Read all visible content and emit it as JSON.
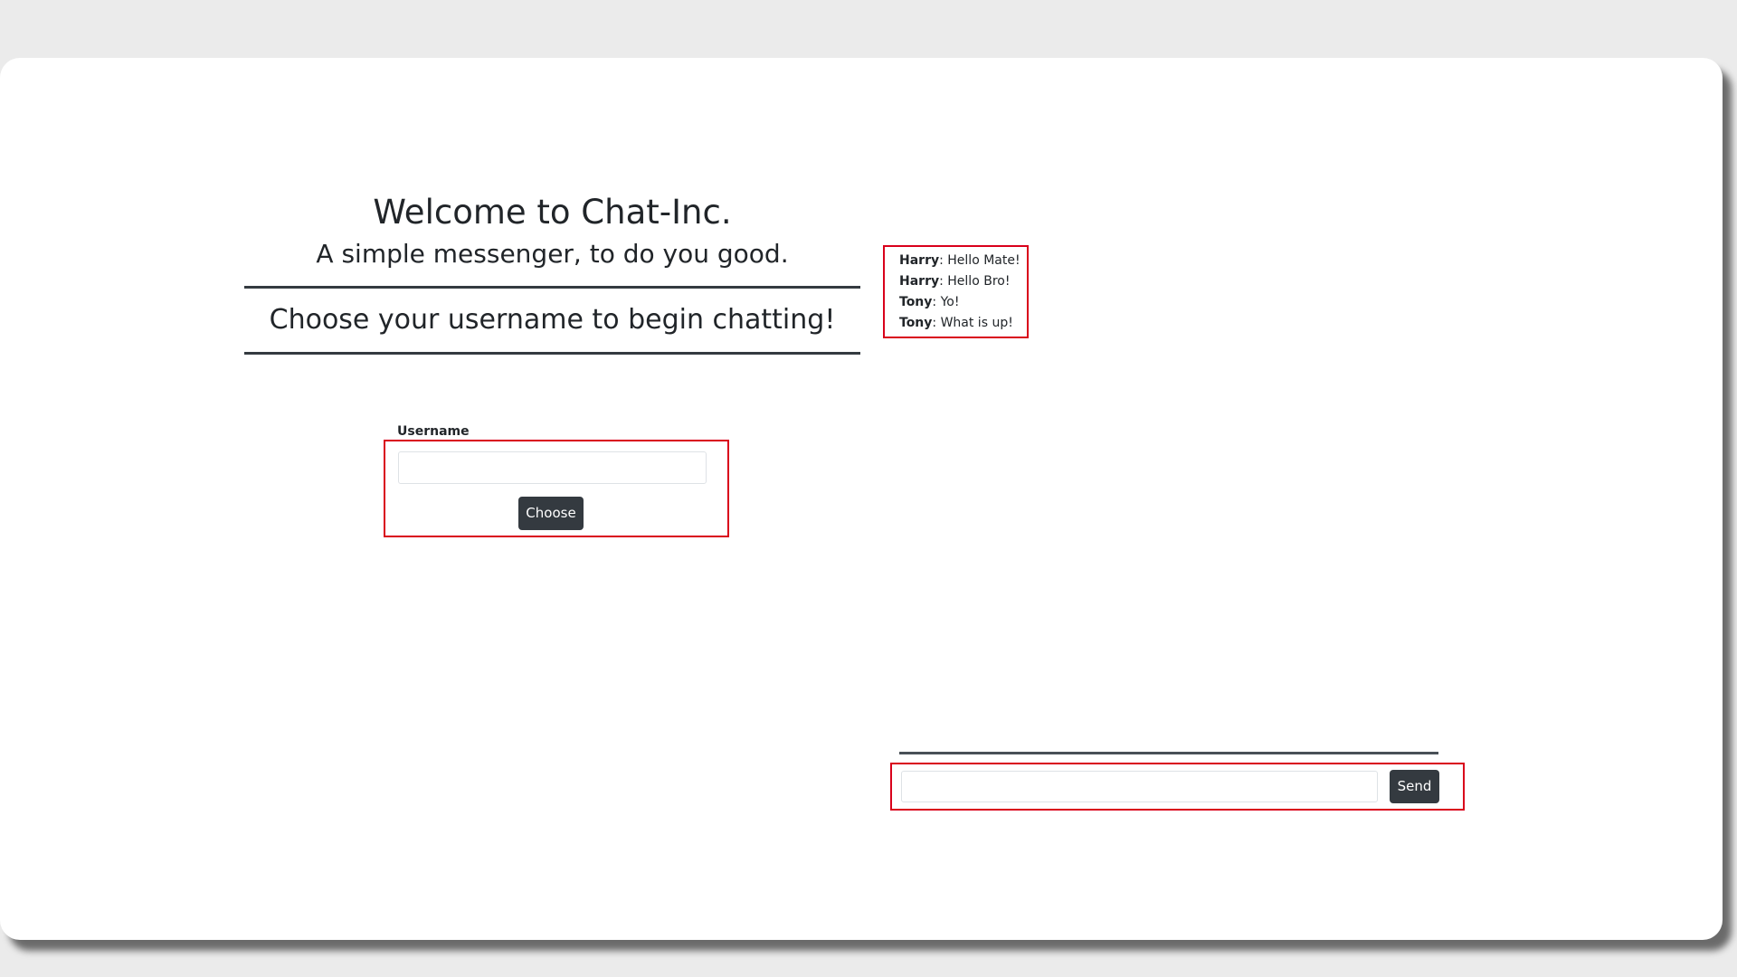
{
  "welcome": {
    "title": "Welcome to Chat-Inc.",
    "subtitle": "A simple messenger, to do you good.",
    "prompt": "Choose your username to begin chatting!"
  },
  "username_form": {
    "label": "Username",
    "value": "",
    "button_label": "Choose"
  },
  "messages": [
    {
      "user": "Harry",
      "text": ": Hello Mate!"
    },
    {
      "user": "Harry",
      "text": ": Hello Bro!"
    },
    {
      "user": "Tony",
      "text": ": Yo!"
    },
    {
      "user": "Tony",
      "text": ": What is up!"
    }
  ],
  "composer": {
    "value": "",
    "send_label": "Send"
  },
  "colors": {
    "highlight_border": "#d9001b",
    "button_bg": "#343a40",
    "page_bg": "#ebebeb"
  }
}
